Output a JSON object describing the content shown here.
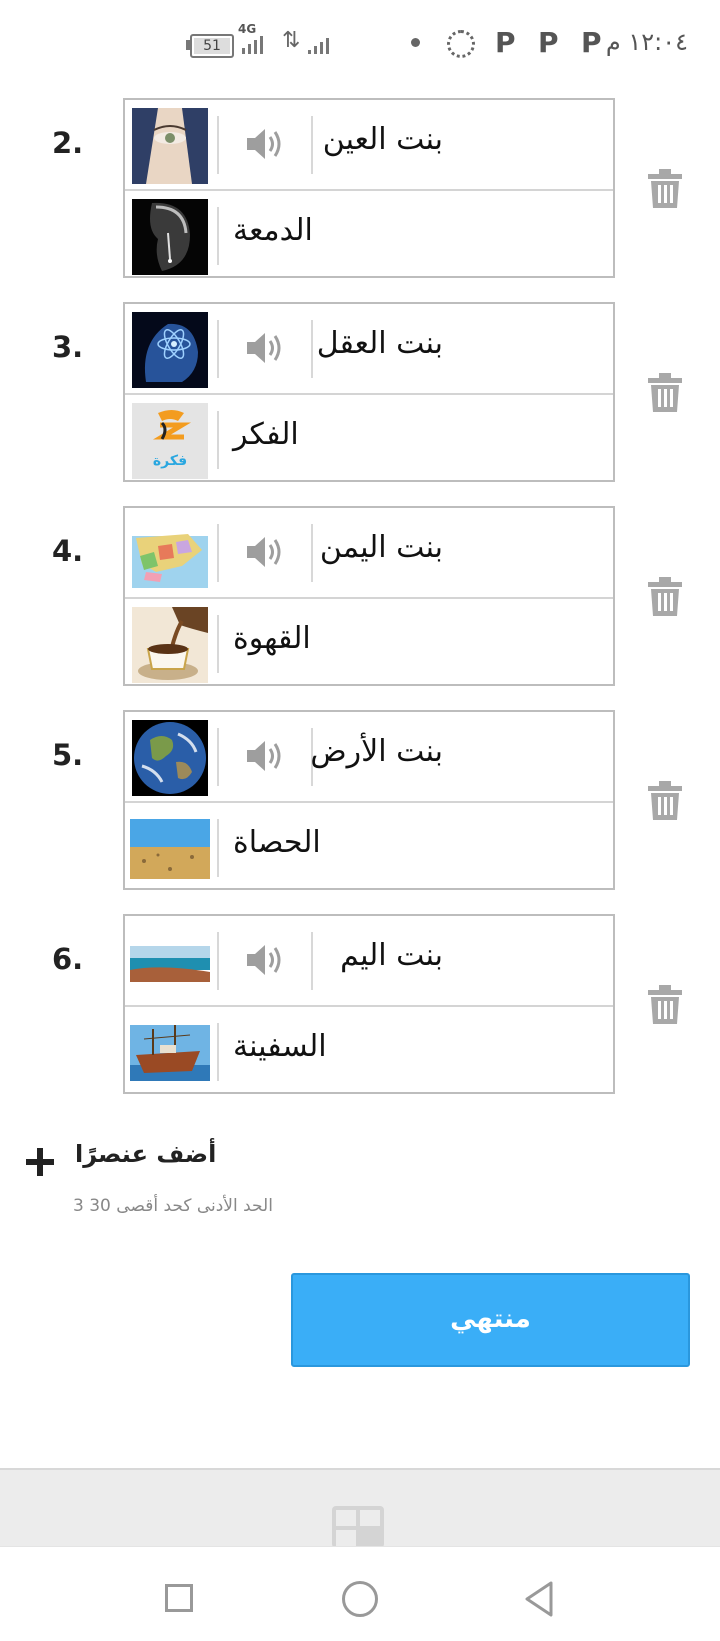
{
  "status_bar": {
    "time": "١٢:٠٤ م",
    "notification_icons": [
      "P",
      "P",
      "P"
    ],
    "network": "4G",
    "battery": "51"
  },
  "items": [
    {
      "number": "2.",
      "prompt": "بنت العين",
      "answer": "الدمعة",
      "prompt_image": "woman-eye-image",
      "answer_image": "tear-face-image"
    },
    {
      "number": "3.",
      "prompt": "بنت العقل",
      "answer": "الفكر",
      "prompt_image": "brain-atom-image",
      "answer_image": "idea-logo-image",
      "answer_image_text": "فكرة"
    },
    {
      "number": "4.",
      "prompt": "بنت اليمن",
      "answer": "القهوة",
      "prompt_image": "yemen-map-image",
      "answer_image": "coffee-cup-image"
    },
    {
      "number": "5.",
      "prompt": "بنت الأرض",
      "answer": "الحصاة",
      "prompt_image": "earth-globe-image",
      "answer_image": "desert-pebbles-image"
    },
    {
      "number": "6.",
      "prompt": "بنت اليم",
      "answer": "السفينة",
      "prompt_image": "sea-shore-image",
      "answer_image": "ship-image"
    }
  ],
  "add_item": {
    "label": "أضف عنصرًا",
    "hint": "الحد الأدنى كحد أقصى 30 3"
  },
  "done_button": {
    "label": "منتهي"
  },
  "colors": {
    "accent": "#3aaef7",
    "border": "#bdbdbd",
    "icon_gray": "#9e9e9e"
  }
}
